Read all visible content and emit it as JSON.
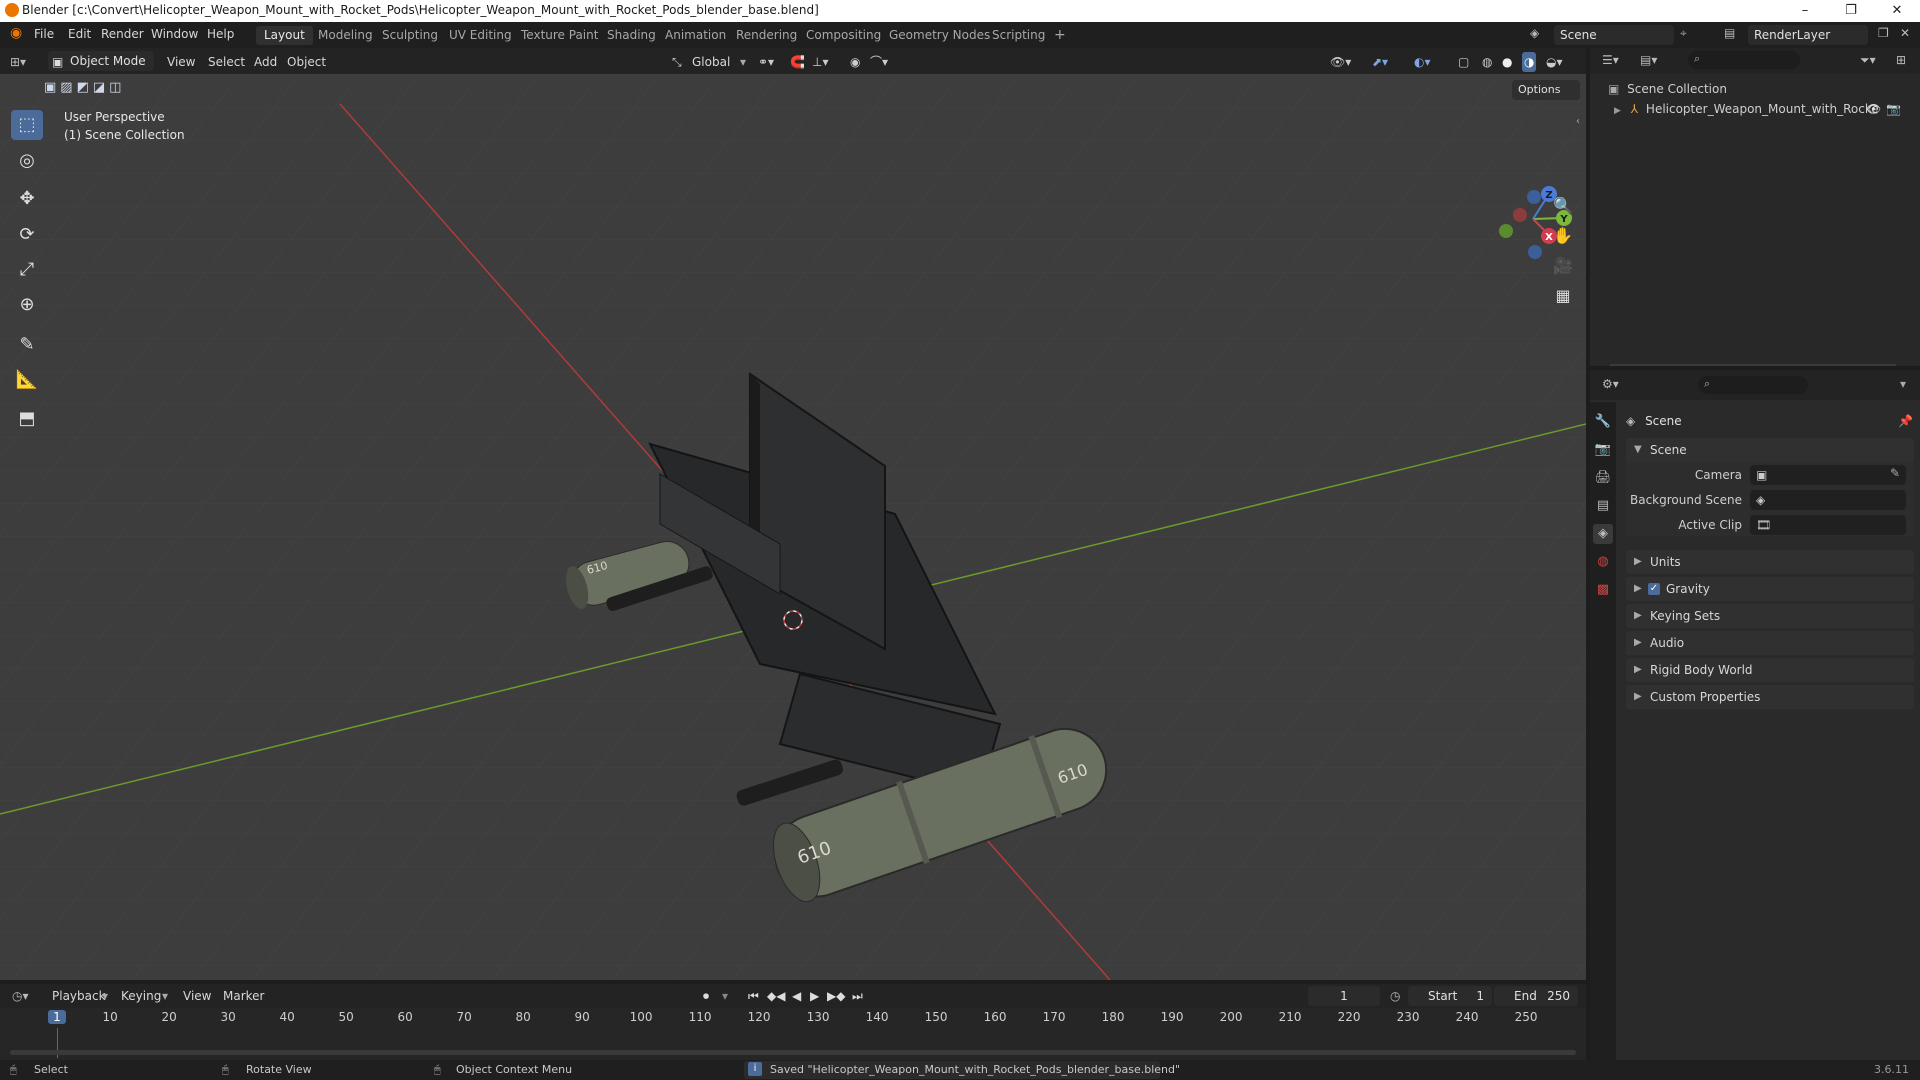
{
  "window": {
    "title": "Blender [c:\\Convert\\Helicopter_Weapon_Mount_with_Rocket_Pods\\Helicopter_Weapon_Mount_with_Rocket_Pods_blender_base.blend]",
    "minimize": "–",
    "maximize": "❐",
    "close": "✕"
  },
  "menubar": {
    "items": [
      "File",
      "Edit",
      "Render",
      "Window",
      "Help"
    ],
    "workspaces": [
      "Layout",
      "Modeling",
      "Sculpting",
      "UV Editing",
      "Texture Paint",
      "Shading",
      "Animation",
      "Rendering",
      "Compositing",
      "Geometry Nodes",
      "Scripting"
    ],
    "active_workspace": "Layout",
    "add_workspace": "+",
    "scene_name": "Scene",
    "view_layer": "RenderLayer"
  },
  "viewport_header": {
    "mode": "Object Mode",
    "menus": [
      "View",
      "Select",
      "Add",
      "Object"
    ],
    "transform_orientation": "Global",
    "options": "Options"
  },
  "viewport": {
    "overlay_line1": "User Perspective",
    "overlay_line2": "(1) Scene Collection",
    "gizmo_labels": {
      "x": "X",
      "y": "Y",
      "z": "Z"
    },
    "pod_label": "610"
  },
  "outliner": {
    "root": "Scene Collection",
    "object": "Helicopter_Weapon_Mount_with_Rocke"
  },
  "properties": {
    "context_title": "Scene",
    "scene_panel": "Scene",
    "camera_label": "Camera",
    "background_scene_label": "Background Scene",
    "active_clip_label": "Active Clip",
    "panels": [
      "Units",
      "Gravity",
      "Keying Sets",
      "Audio",
      "Rigid Body World",
      "Custom Properties"
    ],
    "gravity_checked": true
  },
  "timeline": {
    "menus": [
      "Playback",
      "Keying",
      "View",
      "Marker"
    ],
    "current_frame": "1",
    "start_label": "Start",
    "start": "1",
    "end_label": "End",
    "end": "250",
    "ticks": [
      "1",
      "10",
      "20",
      "30",
      "40",
      "50",
      "60",
      "70",
      "80",
      "90",
      "100",
      "110",
      "120",
      "130",
      "140",
      "150",
      "160",
      "170",
      "180",
      "190",
      "200",
      "210",
      "220",
      "230",
      "240",
      "250"
    ]
  },
  "statusbar": {
    "select": "Select",
    "rotate": "Rotate View",
    "context_menu": "Object Context Menu",
    "message": "Saved \"Helicopter_Weapon_Mount_with_Rocket_Pods_blender_base.blend\"",
    "version": "3.6.11"
  },
  "colors": {
    "accent": "#4b6b9a",
    "axis_x": "#c93636",
    "axis_y": "#6a9b2c",
    "header": "#232323",
    "viewport_bg": "#3d3d3d"
  }
}
